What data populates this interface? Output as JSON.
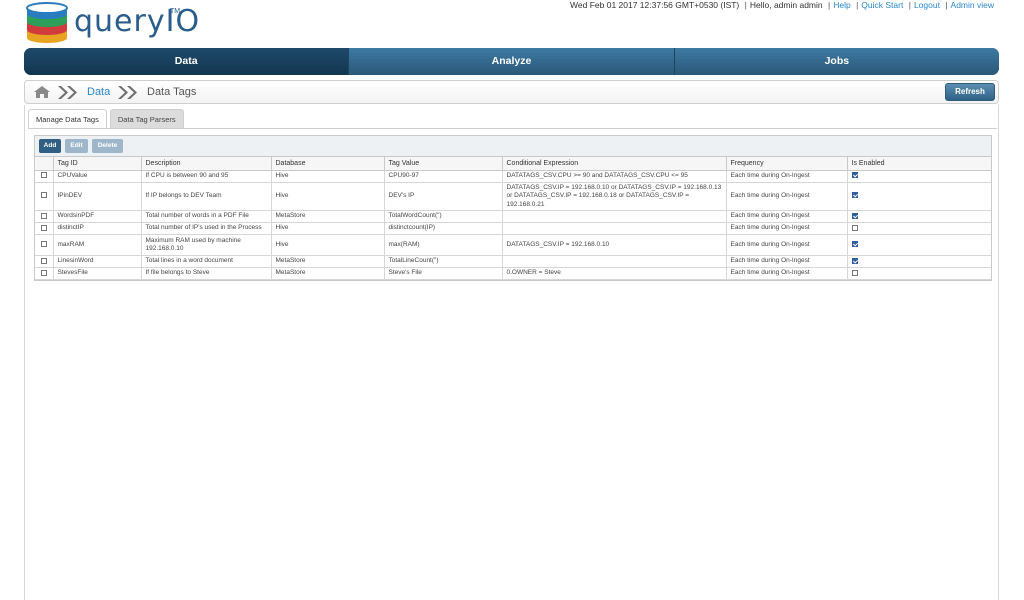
{
  "header": {
    "logo_text": "queryIO",
    "logo_tm": "TM",
    "datetime": "Wed Feb 01 2017 12:37:56 GMT+0530 (IST)",
    "greeting": "Hello,  admin admin",
    "links": [
      "Help",
      "Quick Start",
      "Logout",
      "Admin view"
    ]
  },
  "nav": {
    "tabs": [
      "Data",
      "Analyze",
      "Jobs"
    ],
    "active": "Data"
  },
  "breadcrumb": {
    "home_icon": "home-icon",
    "items": [
      "Data",
      "Data Tags"
    ]
  },
  "refresh_label": "Refresh",
  "subtabs": [
    "Manage Data Tags",
    "Data Tag Parsers"
  ],
  "toolbar": {
    "add": "Add",
    "edit": "Edit",
    "delete": "Delete"
  },
  "table": {
    "headers": [
      "",
      "Tag ID",
      "Description",
      "Database",
      "Tag Value",
      "Conditional Expression",
      "Frequency",
      "Is Enabled"
    ],
    "rows": [
      {
        "tag_id": "CPUValue",
        "description": "If CPU is between 90 and 95",
        "database": "Hive",
        "tag_value": "CPU90-97",
        "condition": "DATATAGS_CSV.CPU >= 90 and DATATAGS_CSV.CPU <= 95",
        "frequency": "Each time during On-Ingest",
        "enabled": true
      },
      {
        "tag_id": "IPinDEV",
        "description": "If IP belongs to DEV Team",
        "database": "Hive",
        "tag_value": "DEV's IP",
        "condition": "DATATAGS_CSV.IP = 192.168.0.10 or DATATAGS_CSV.IP = 192.168.0.13 or DATATAGS_CSV.IP = 192.168.0.18 or DATATAGS_CSV.IP = 192.168.0.21",
        "frequency": "Each time during On-Ingest",
        "enabled": true
      },
      {
        "tag_id": "WordsinPDF",
        "description": "Total number of words in a PDF File",
        "database": "MetaStore",
        "tag_value": "TotalWordCount(\")",
        "condition": "",
        "frequency": "Each time during On-Ingest",
        "enabled": true
      },
      {
        "tag_id": "distinctIP",
        "description": "Total number of IP's used in the Process",
        "database": "Hive",
        "tag_value": "distinctcount(IP)",
        "condition": "",
        "frequency": "Each time during On-Ingest",
        "enabled": false
      },
      {
        "tag_id": "maxRAM",
        "description": "Maximum RAM used by machine 192.168.0.10",
        "database": "Hive",
        "tag_value": "max(RAM)",
        "condition": "DATATAGS_CSV.IP = 192.168.0.10",
        "frequency": "Each time during On-Ingest",
        "enabled": true
      },
      {
        "tag_id": "LinesinWord",
        "description": "Total lines in a word document",
        "database": "MetaStore",
        "tag_value": "TotalLineCount(\")",
        "condition": "",
        "frequency": "Each time during On-Ingest",
        "enabled": true
      },
      {
        "tag_id": "StevesFile",
        "description": "If file belongs to Steve",
        "database": "MetaStore",
        "tag_value": "Steve's File",
        "condition": "0.OWNER = Steve",
        "frequency": "Each time during On-Ingest",
        "enabled": false
      }
    ]
  }
}
